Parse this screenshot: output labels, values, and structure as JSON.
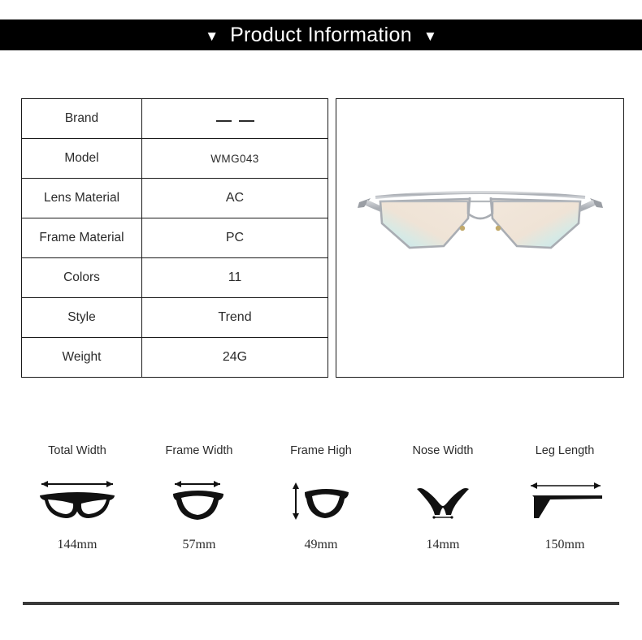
{
  "header": {
    "title": "Product Information",
    "left_marker": "▼",
    "right_marker": "▼",
    "background_color": "#000000",
    "text_color": "#ffffff"
  },
  "spec_table": {
    "rows": [
      {
        "label": "Brand",
        "value": "—  —",
        "value_is_dashes": true
      },
      {
        "label": "Model",
        "value": "WMG043"
      },
      {
        "label": "Lens Material",
        "value": "AC"
      },
      {
        "label": "Frame Material",
        "value": "PC"
      },
      {
        "label": "Colors",
        "value": "11"
      },
      {
        "label": "Style",
        "value": "Trend"
      },
      {
        "label": "Weight",
        "value": "24G"
      }
    ]
  },
  "product_image": {
    "alt": "aviator sunglasses front view",
    "frame_color": "#b9bcc0",
    "lens_color": "#efe2d4",
    "lens_accent_color": "#b8e4ee"
  },
  "measurements": [
    {
      "label": "Total Width",
      "value": "144mm",
      "icon": "full-frame-front-icon"
    },
    {
      "label": "Frame Width",
      "value": "57mm",
      "icon": "single-lens-width-icon"
    },
    {
      "label": "Frame High",
      "value": "49mm",
      "icon": "single-lens-height-icon"
    },
    {
      "label": "Nose Width",
      "value": "14mm",
      "icon": "nose-bridge-icon"
    },
    {
      "label": "Leg Length",
      "value": "150mm",
      "icon": "temple-arm-icon"
    }
  ],
  "footer": {
    "divider_color": "#3a3a3a"
  }
}
